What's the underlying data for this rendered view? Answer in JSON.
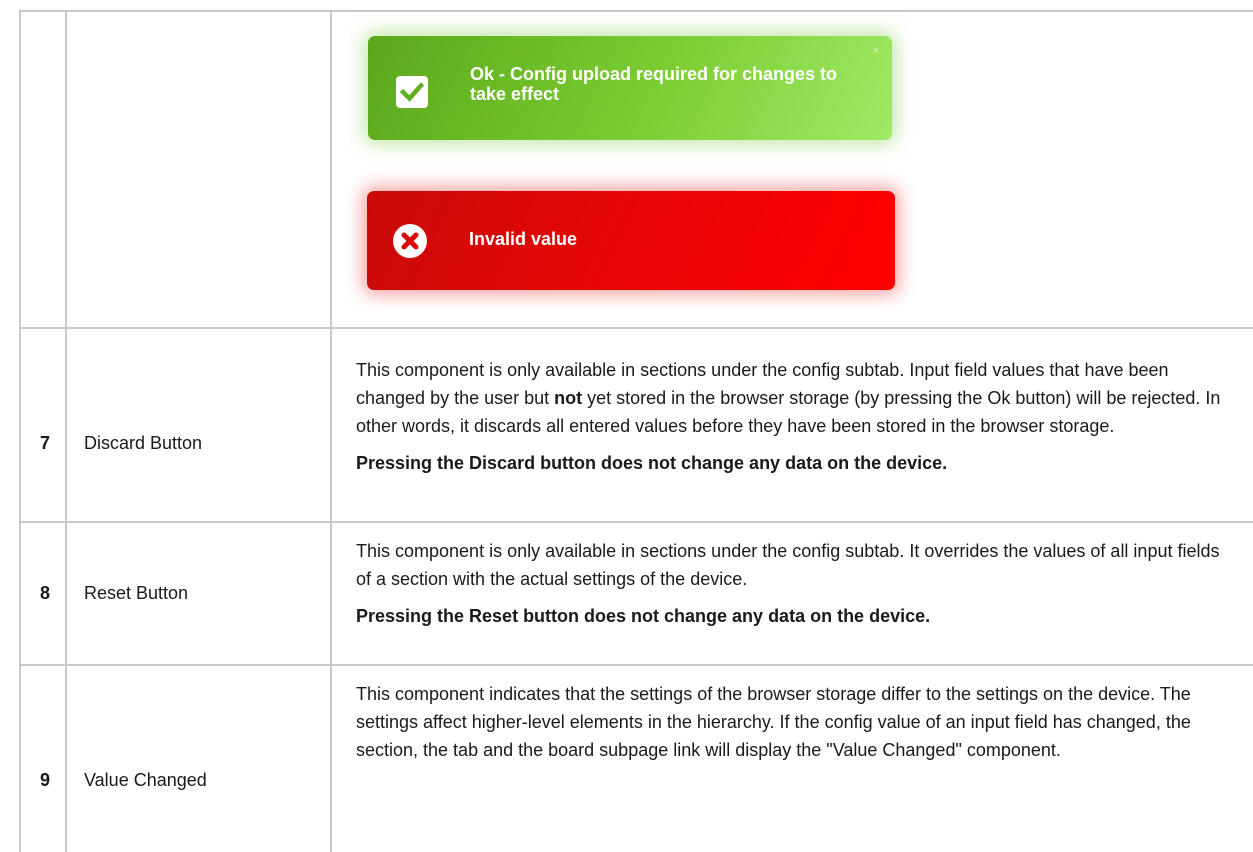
{
  "toasts": {
    "ok": {
      "message": "Ok - Config upload required for changes to take effect",
      "icon": "check-icon",
      "close": "×"
    },
    "error": {
      "message": "Invalid value",
      "icon": "error-x-icon"
    }
  },
  "rows": [
    {
      "number": "7",
      "name": "Discard Button",
      "text_a": "This component is only available in sections under the config subtab. Input field values that have been changed by the user but ",
      "text_bold": "not",
      "text_b": " yet stored in the browser storage (by pressing the Ok button) will be rejected. In other words, it discards all entered values before they have been stored in the browser storage.",
      "note": "Pressing the Discard button does not change any data on the device."
    },
    {
      "number": "8",
      "name": "Reset Button",
      "text": "This component is only available in sections under the config subtab. It overrides the values of all input fields of a section with the actual settings of the device.",
      "note": "Pressing the Reset button does not change any data on the device."
    },
    {
      "number": "9",
      "name": "Value Changed",
      "text": "This component indicates that the settings of the browser storage differ to the settings on the device. The settings affect higher-level elements in the hierarchy. If the config value of an input field has changed, the section, the tab and the board subpage link will display the \"Value Changed\" component."
    }
  ]
}
